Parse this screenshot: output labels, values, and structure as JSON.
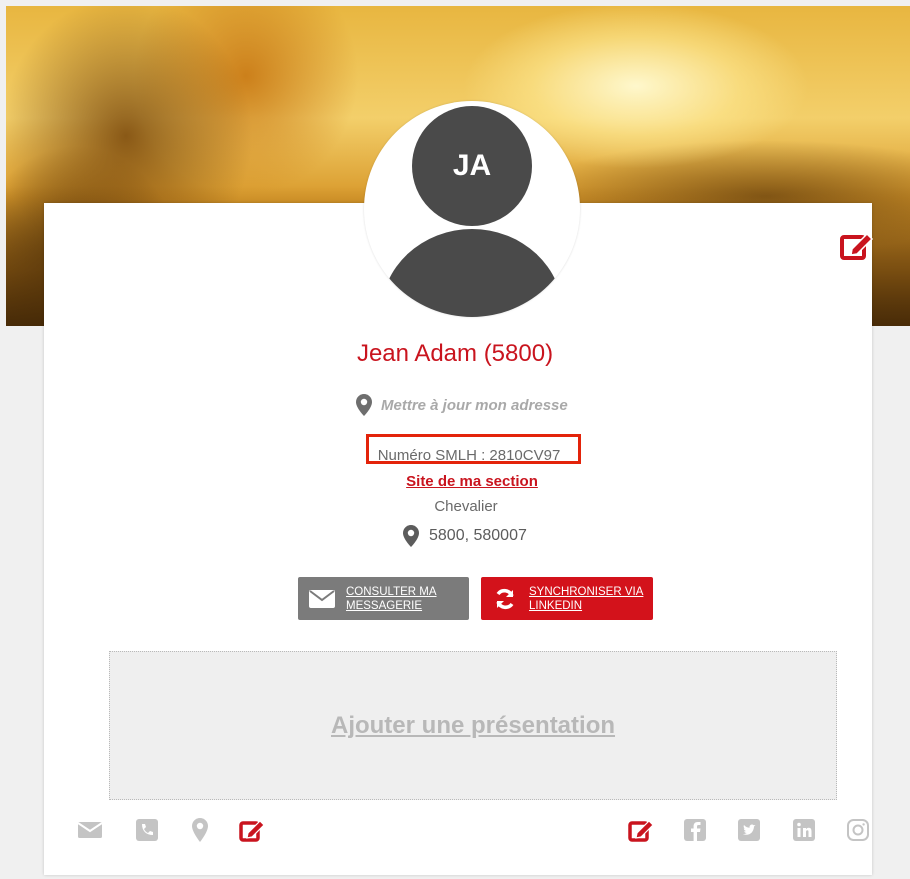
{
  "profile": {
    "initials": "JA",
    "name": "Jean Adam (5800)",
    "address_prompt": "Mettre à jour mon adresse",
    "smlh_number": "Numéro SMLH : 2810CV97",
    "section_link": "Site de ma section",
    "rank": "Chevalier",
    "location": "5800, 580007"
  },
  "actions": {
    "messaging_label": "CONSULTER MA\nMESSAGERIE",
    "linkedin_label": "SYNCHRONISER VIA\nLINKEDIN"
  },
  "presentation": {
    "add_label": "Ajouter une présentation"
  },
  "footer": {
    "contact_icons": [
      "mail-icon",
      "phone-icon",
      "map-pin-icon",
      "edit-icon"
    ],
    "social_icons": [
      "edit-icon",
      "facebook-icon",
      "twitter-icon",
      "linkedin-icon",
      "instagram-icon"
    ]
  },
  "colors": {
    "accent": "#c9141e",
    "button_grey": "#7b7b7b",
    "button_red": "#d3121b",
    "highlight_box": "#e3230a",
    "icon_grey": "#c4c4c4"
  }
}
